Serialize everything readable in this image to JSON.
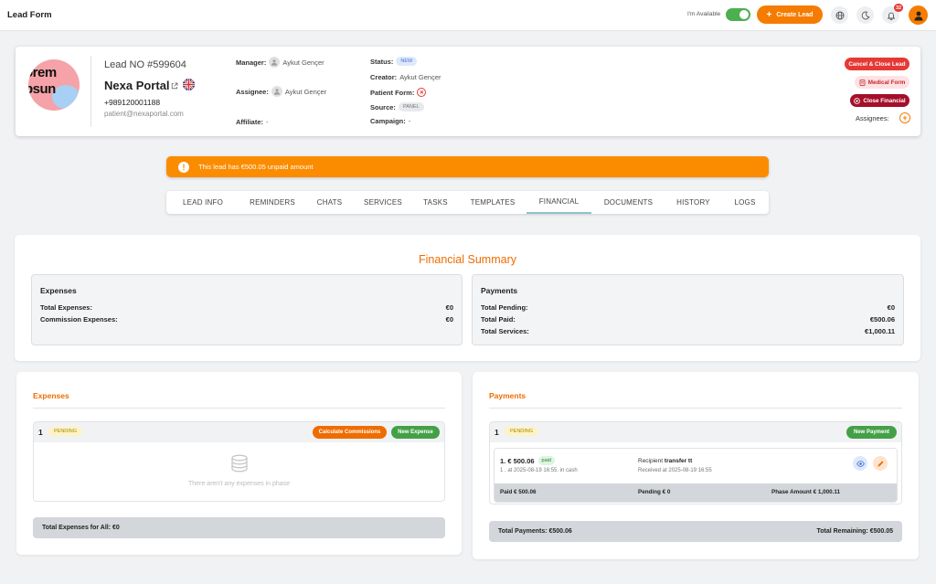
{
  "topbar": {
    "title": "Lead Form",
    "availability_label": "I'm Available",
    "create_lead_label": "Create Lead",
    "notification_count": "32"
  },
  "lead": {
    "avatar_text_1": "orem",
    "avatar_text_2": "psun",
    "lead_no": "Lead NO #599604",
    "name": "Nexa Portal",
    "phone": "+989120001188",
    "email": "patient@nexaportal.com",
    "manager_label": "Manager:",
    "manager_value": "Aykut Gençer",
    "assignee_label": "Assignee:",
    "assignee_value": "Aykut Gençer",
    "affiliate_label": "Affiliate:",
    "affiliate_value": "-",
    "status_label": "Status:",
    "status_value": "NEW",
    "creator_label": "Creator:",
    "creator_value": "Aykut Gençer",
    "patient_form_label": "Patient Form:",
    "source_label": "Source:",
    "source_value": "PANEL",
    "campaign_label": "Campaign:",
    "campaign_value": "-",
    "cancel_close_label": "Cancel & Close Lead",
    "medical_form_label": "Medical Form",
    "close_financial_label": "Close Financial",
    "assignees_label": "Assignees:"
  },
  "alert": {
    "message": "This lead has €500.05 unpaid amount"
  },
  "tabs": [
    {
      "label": "LEAD INFO"
    },
    {
      "label": "REMINDERS"
    },
    {
      "label": "CHATS"
    },
    {
      "label": "SERVICES"
    },
    {
      "label": "TASKS"
    },
    {
      "label": "TEMPLATES"
    },
    {
      "label": "FINANCIAL"
    },
    {
      "label": "DOCUMENTS"
    },
    {
      "label": "HISTORY"
    },
    {
      "label": "LOGS"
    }
  ],
  "summary": {
    "title": "Financial Summary",
    "expenses": {
      "heading": "Expenses",
      "total_label": "Total Expenses:",
      "total_value": "€0",
      "commission_label": "Commission Expenses:",
      "commission_value": "€0"
    },
    "payments": {
      "heading": "Payments",
      "pending_label": "Total Pending:",
      "pending_value": "€0",
      "paid_label": "Total Paid:",
      "paid_value": "€500.06",
      "services_label": "Total Services:",
      "services_value": "€1,000.11"
    }
  },
  "expenses_panel": {
    "title": "Expenses",
    "phase_num": "1",
    "phase_status": "PENDING",
    "calc_commissions_label": "Calculate Commissions",
    "new_expense_label": "New Expense",
    "empty_text": "There aren't any expenses in phase",
    "total_label": "Total Expenses for All:  €0"
  },
  "payments_panel": {
    "title": "Payments",
    "phase_num": "1",
    "phase_status": "PENDING",
    "new_payment_label": "New Payment",
    "item": {
      "amount": "1. € 500.06",
      "status": "paid",
      "sub": "1 . at 2025-08-19 16:55. in cash",
      "recipient_label": "Recipient",
      "recipient_value": "transfer tt",
      "received": "Received at 2025-08-19 16:55",
      "paid": "Paid € 500.06",
      "pending": "Pending € 0",
      "phase_amount": "Phase Amount € 1,000.11"
    },
    "total_payments": "Total Payments: €500.06",
    "total_remaining": "Total Remaining: €500.05"
  }
}
